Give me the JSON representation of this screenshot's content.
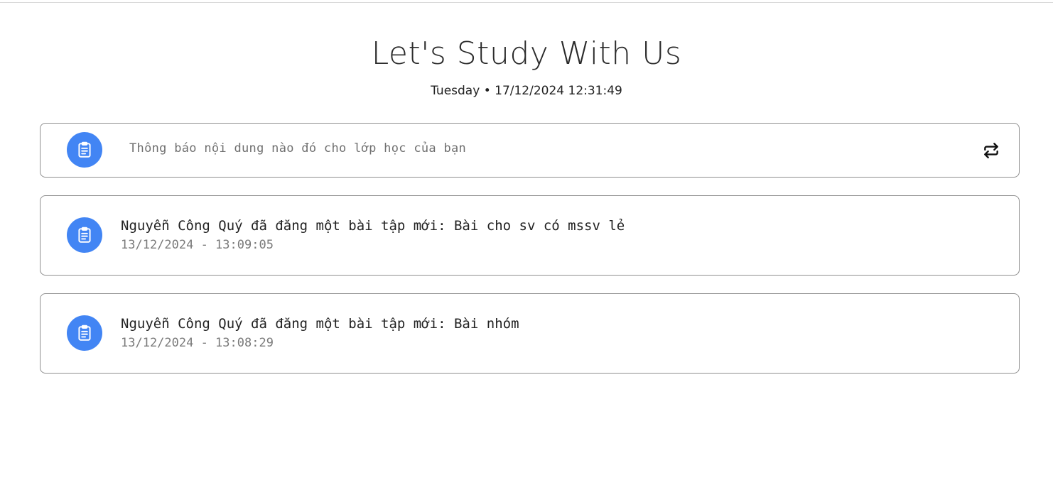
{
  "header": {
    "title": "Let's Study With Us",
    "date_line": "Tuesday • 17/12/2024 12:31:49"
  },
  "composer": {
    "placeholder": "Thông báo nội dung nào đó cho lớp học của bạn",
    "avatar_icon": "clipboard-icon",
    "action_icon": "repost-icon"
  },
  "posts": [
    {
      "icon": "clipboard-icon",
      "text": "Nguyễn Công Quý đã đăng một bài tập mới: Bài cho sv có mssv lẻ",
      "timestamp": "13/12/2024 - 13:09:05"
    },
    {
      "icon": "clipboard-icon",
      "text": "Nguyễn Công Quý đã đăng một bài tập mới: Bài nhóm",
      "timestamp": "13/12/2024 - 13:08:29"
    }
  ],
  "colors": {
    "accent": "#4285f4",
    "border": "#8f8f8f",
    "text": "#222222",
    "muted": "#7a7a7a"
  }
}
